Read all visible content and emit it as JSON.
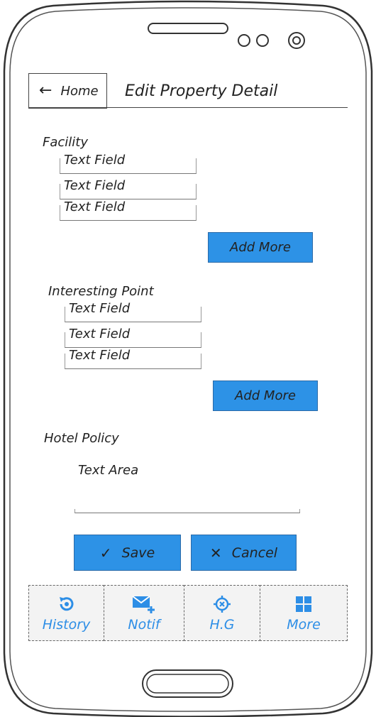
{
  "header": {
    "back_label": "Home",
    "title": "Edit Property Detail"
  },
  "facility": {
    "label": "Facility",
    "fields": [
      "Text Field",
      "Text Field",
      "Text Field"
    ],
    "add_more": "Add More"
  },
  "interesting_point": {
    "label": "Interesting Point",
    "fields": [
      "Text Field",
      "Text Field",
      "Text Field"
    ],
    "add_more": "Add More"
  },
  "hotel_policy": {
    "label": "Hotel Policy",
    "textarea": "Text Area"
  },
  "actions": {
    "save": "Save",
    "cancel": "Cancel"
  },
  "tabs": [
    {
      "label": "History",
      "icon": "history-icon"
    },
    {
      "label": "Notif",
      "icon": "mail-add-icon"
    },
    {
      "label": "H.G",
      "icon": "crosshair-icon"
    },
    {
      "label": "More",
      "icon": "grid-icon"
    }
  ],
  "colors": {
    "accent": "#2d92e6",
    "tab_text": "#2d8ee6"
  }
}
